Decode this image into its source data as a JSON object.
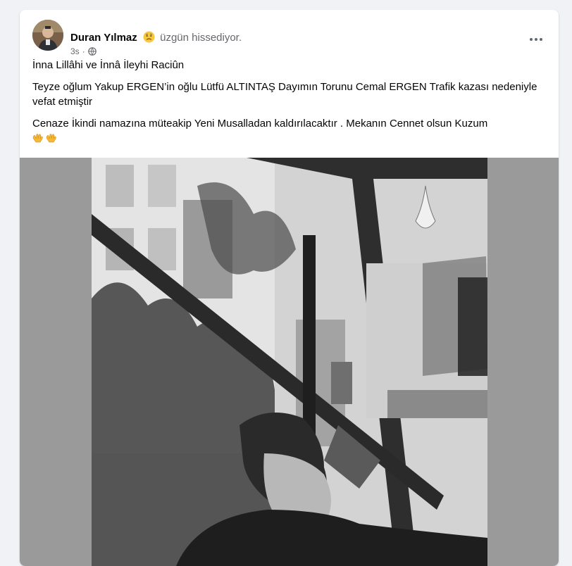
{
  "post": {
    "author": "Duran Yılmaz",
    "feeling": "üzgün hissediyor.",
    "time": "3s",
    "separator": "·",
    "paragraphs": [
      "İnna Lillâhi ve İnnâ İleyhi Raciûn",
      "Teyze oğlum Yakup ERGEN’in oğlu Lütfü ALTINTAŞ Dayımın Torunu Cemal ERGEN Trafik kazası nedeniyle vefat etmiştir",
      "Cenaze İkindi namazına müteakip Yeni Musalladan kaldırılacaktır . Mekanın Cennet olsun Kuzum"
    ]
  },
  "icons": {
    "feeling": "sad-face-icon",
    "privacy": "globe-icon",
    "more": "more-options-icon",
    "emoji": "open-hands-icon"
  },
  "colors": {
    "background": "#f0f2f5",
    "card": "#ffffff",
    "text": "#050505",
    "secondary_text": "#65676b"
  }
}
